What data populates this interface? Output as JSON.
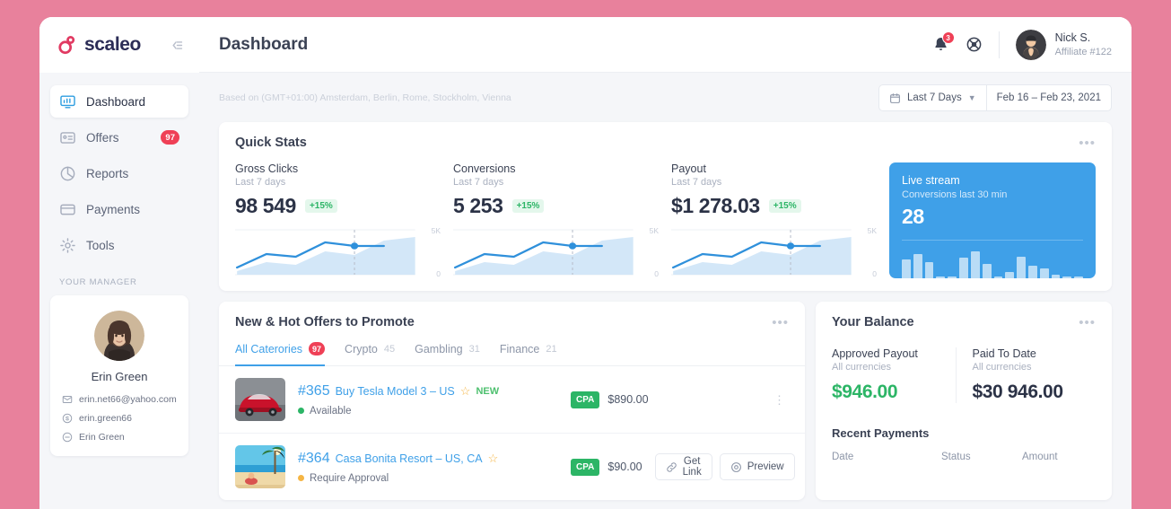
{
  "theme": {
    "frame_pink": "#e8819c",
    "accent_blue": "#3fa0e8",
    "brand_navy": "#2b2c56",
    "brand_pink": "#e13a62",
    "green": "#2cb566",
    "red_badge": "#ef4056"
  },
  "sidebar": {
    "logo_text": "scaleo",
    "collapse_icon": "collapse-left-icon",
    "items": [
      {
        "label": "Dashboard",
        "icon": "dashboard-monitor-icon",
        "active": true,
        "badge": ""
      },
      {
        "label": "Offers",
        "icon": "id-card-icon",
        "active": false,
        "badge": "97"
      },
      {
        "label": "Reports",
        "icon": "pie-chart-icon",
        "active": false,
        "badge": ""
      },
      {
        "label": "Payments",
        "icon": "credit-card-icon",
        "active": false,
        "badge": ""
      },
      {
        "label": "Tools",
        "icon": "gear-icon",
        "active": false,
        "badge": ""
      }
    ],
    "manager": {
      "section_title": "YOUR MANAGER",
      "name": "Erin Green",
      "contacts": [
        {
          "icon": "envelope-icon",
          "value": "erin.net66@yahoo.com"
        },
        {
          "icon": "skype-icon",
          "value": "erin.green66"
        },
        {
          "icon": "telegram-icon",
          "value": "Erin Green"
        }
      ]
    }
  },
  "topbar": {
    "title": "Dashboard",
    "bell_icon": "bell-icon",
    "bell_badge": "3",
    "help_icon": "help-globe-icon",
    "user_name": "Nick S.",
    "user_sub": "Affiliate #122"
  },
  "toolbar": {
    "timezone_note": "Based on (GMT+01:00) Amsterdam, Berlin, Rome, Stockholm, Vienna",
    "range_label": "Last 7 Days",
    "calendar_icon": "calendar-icon",
    "chevron_icon": "chevron-down-icon",
    "date_range": "Feb 16 – Feb 23, 2021"
  },
  "quick_stats": {
    "title": "Quick Stats",
    "menu_icon": "ellipsis-icon",
    "stats": [
      {
        "label": "Gross Clicks",
        "sub": "Last 7 days",
        "value": "98 549",
        "delta": "+15%"
      },
      {
        "label": "Conversions",
        "sub": "Last 7 days",
        "value": "5 253",
        "delta": "+15%"
      },
      {
        "label": "Payout",
        "sub": "Last 7 days",
        "value": "$1 278.03",
        "delta": "+15%"
      }
    ],
    "axis_max": "5K",
    "axis_min": "0",
    "live": {
      "title": "Live stream",
      "sub": "Conversions last 30 min",
      "value": "28"
    }
  },
  "chart_data": [
    {
      "type": "line",
      "title": "Gross Clicks",
      "x": [
        "1",
        "2",
        "3",
        "4",
        "5",
        "6",
        "7"
      ],
      "values": [
        900,
        2400,
        2050,
        3400,
        3050,
        4300,
        3900
      ],
      "ylim": [
        0,
        5000
      ],
      "ylabel": "",
      "tick_labels": [
        "5K",
        "0"
      ],
      "grid": false,
      "legend": "none"
    },
    {
      "type": "line",
      "title": "Conversions",
      "x": [
        "1",
        "2",
        "3",
        "4",
        "5",
        "6",
        "7"
      ],
      "values": [
        900,
        2400,
        2050,
        3400,
        3050,
        4300,
        3900
      ],
      "ylim": [
        0,
        5000
      ],
      "tick_labels": [
        "5K",
        "0"
      ],
      "grid": false,
      "legend": "none"
    },
    {
      "type": "line",
      "title": "Payout",
      "x": [
        "1",
        "2",
        "3",
        "4",
        "5",
        "6",
        "7"
      ],
      "values": [
        900,
        2400,
        2050,
        3400,
        3050,
        4300,
        3900
      ],
      "ylim": [
        0,
        5000
      ],
      "tick_labels": [
        "5K",
        "0"
      ],
      "grid": false,
      "legend": "none"
    },
    {
      "type": "bar",
      "title": "Live stream — Conversions last 30 min",
      "categories": [
        "1",
        "2",
        "3",
        "4",
        "5",
        "6",
        "7",
        "8",
        "9",
        "10",
        "11",
        "12",
        "13",
        "14",
        "15",
        "16"
      ],
      "values": [
        62,
        80,
        52,
        3,
        3,
        68,
        88,
        48,
        2,
        22,
        72,
        40,
        32,
        12,
        3,
        3
      ],
      "ylim": [
        0,
        100
      ],
      "grid": false,
      "legend": "none"
    }
  ],
  "offers": {
    "title": "New & Hot Offers to Promote",
    "menu_icon": "ellipsis-icon",
    "tabs": [
      {
        "label": "All Caterories",
        "badge": "97",
        "count": "",
        "active": true
      },
      {
        "label": "Crypto",
        "badge": "",
        "count": "45",
        "active": false
      },
      {
        "label": "Gambling",
        "badge": "",
        "count": "31",
        "active": false
      },
      {
        "label": "Finance",
        "badge": "",
        "count": "21",
        "active": false
      }
    ],
    "rows": [
      {
        "id": "#365",
        "name": "Buy Tesla Model 3 – US",
        "tag": "NEW",
        "star_icon": "star-outline-icon",
        "status": "Available",
        "status_color": "#2cb566",
        "payout_type": "CPA",
        "payout": "$890.00",
        "thumb": "tesla-car-thumbnail",
        "show_actions": false,
        "menu_icon": "kebab-menu-icon"
      },
      {
        "id": "#364",
        "name": "Casa Bonita Resort – US, CA",
        "tag": "",
        "star_icon": "star-outline-icon",
        "status": "Require Approval",
        "status_color": "#f5b544",
        "payout_type": "CPA",
        "payout": "$90.00",
        "thumb": "beach-resort-thumbnail",
        "show_actions": true,
        "get_link_label": "Get Link",
        "get_link_icon": "link-icon",
        "preview_label": "Preview",
        "preview_icon": "eye-target-icon"
      }
    ]
  },
  "balance": {
    "title": "Your Balance",
    "menu_icon": "ellipsis-icon",
    "approved": {
      "label": "Approved Payout",
      "sub": "All currencies",
      "value": "$946.00",
      "color": "#2cb566"
    },
    "paid": {
      "label": "Paid To Date",
      "sub": "All currencies",
      "value": "$30 946.00",
      "color": "#2b3246"
    },
    "recent_title": "Recent Payments",
    "columns": [
      "Date",
      "Status",
      "Amount"
    ]
  }
}
